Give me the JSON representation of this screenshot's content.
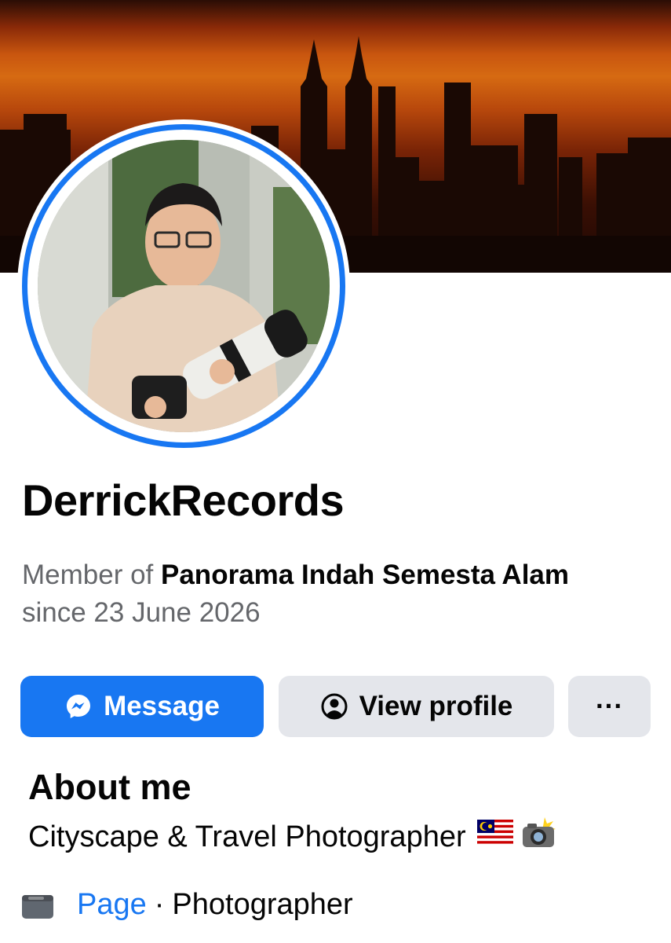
{
  "profile": {
    "name": "DerrickRecords",
    "member_prefix": "Member of ",
    "group_name": "Panorama Indah Semesta Alam",
    "member_since": "since 23 June 2026"
  },
  "actions": {
    "message_label": "Message",
    "view_profile_label": "View profile",
    "more_label": "···"
  },
  "about": {
    "title": "About me",
    "text": "Cityscape & Travel Photographer"
  },
  "page_info": {
    "link_label": "Page",
    "separator": "·",
    "category": "Photographer"
  },
  "icons": {
    "message": "messenger-icon",
    "view_profile": "person-circle-icon",
    "more": "more-icon",
    "page": "page-icon",
    "flag": "malaysia-flag-icon",
    "camera": "camera-flash-icon"
  },
  "colors": {
    "accent": "#1877f2",
    "secondary_button": "#e4e6eb",
    "muted_text": "#65676b"
  }
}
